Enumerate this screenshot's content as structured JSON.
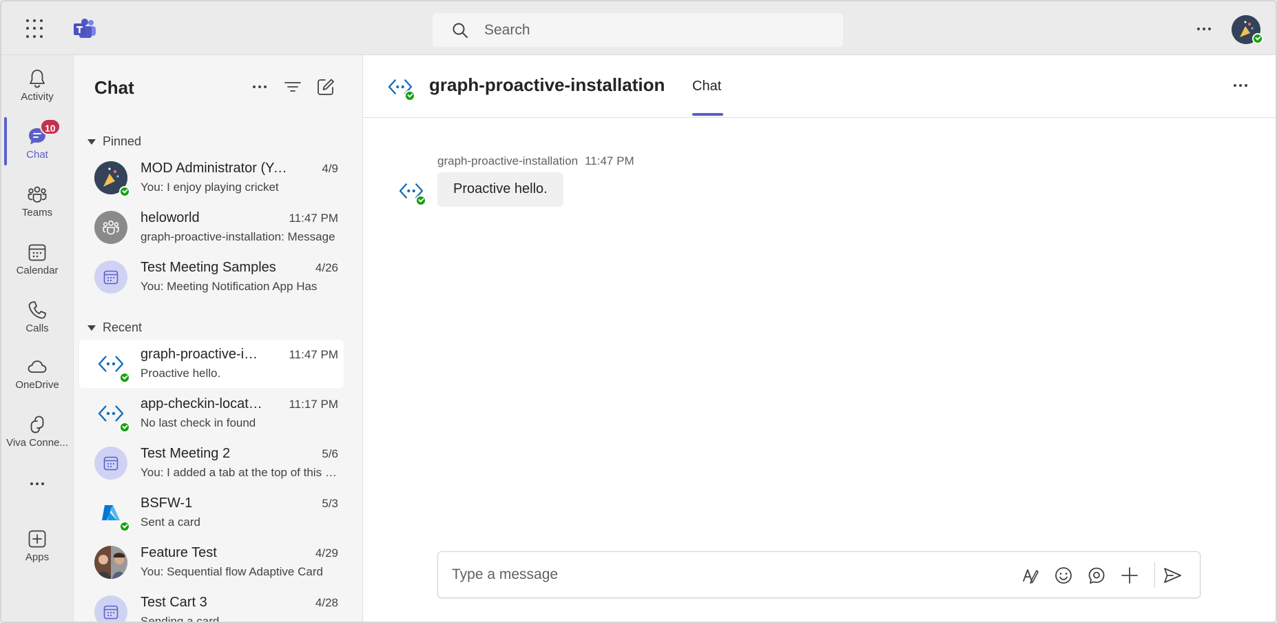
{
  "search": {
    "placeholder": "Search"
  },
  "rail": {
    "items": [
      {
        "label": "Activity"
      },
      {
        "label": "Chat",
        "badge": "10"
      },
      {
        "label": "Teams"
      },
      {
        "label": "Calendar"
      },
      {
        "label": "Calls"
      },
      {
        "label": "OneDrive"
      },
      {
        "label": "Viva Conne..."
      },
      {
        "label": "Apps"
      }
    ]
  },
  "chatlist": {
    "title": "Chat",
    "pinned_label": "Pinned",
    "recent_label": "Recent",
    "pinned": [
      {
        "name": "MOD Administrator (You)",
        "time": "4/9",
        "preview": "You: I enjoy playing cricket"
      },
      {
        "name": "heloworld",
        "time": "11:47 PM",
        "preview": "graph-proactive-installation: Message"
      },
      {
        "name": "Test Meeting Samples",
        "time": "4/26",
        "preview": "You: Meeting Notification App Has"
      }
    ],
    "recent": [
      {
        "name": "graph-proactive-installation",
        "time": "11:47 PM",
        "preview": "Proactive hello."
      },
      {
        "name": "app-checkin-location",
        "time": "11:17 PM",
        "preview": "No last check in found"
      },
      {
        "name": "Test Meeting 2",
        "time": "5/6",
        "preview": "You: I added a tab at the top of this chat"
      },
      {
        "name": "BSFW-1",
        "time": "5/3",
        "preview": "Sent a card"
      },
      {
        "name": "Feature Test",
        "time": "4/29",
        "preview": "You: Sequential flow Adaptive Card"
      },
      {
        "name": "Test Cart 3",
        "time": "4/28",
        "preview": "Sending a card"
      }
    ]
  },
  "conversation": {
    "title": "graph-proactive-installation",
    "tab": "Chat",
    "messages": [
      {
        "sender": "graph-proactive-installation",
        "time": "11:47 PM",
        "text": "Proactive hello."
      }
    ],
    "compose_placeholder": "Type a message"
  },
  "colors": {
    "accent": "#5b5fc7",
    "badge": "#c4314b",
    "presence": "#13a10e",
    "bot_icon": "#0f6cbd"
  }
}
